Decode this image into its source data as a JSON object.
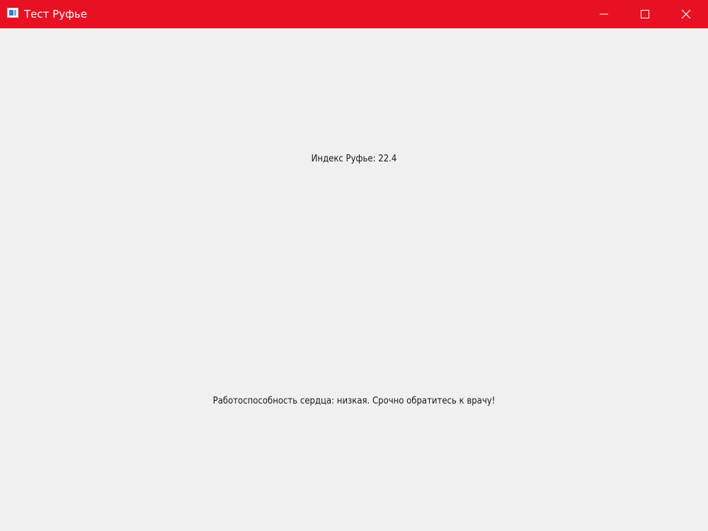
{
  "window": {
    "title": "Тест Руфье",
    "titlebar_color": "#e81123",
    "background_color": "#f0f0f0",
    "controls": {
      "minimize_icon": "minimize-icon",
      "maximize_icon": "maximize-icon",
      "close_icon": "close-icon"
    }
  },
  "main": {
    "index_text": "Индекс Руфье: 22.4",
    "result_text": "Работоспособность сердца: низкая. Срочно обратитесь к врачу!"
  }
}
